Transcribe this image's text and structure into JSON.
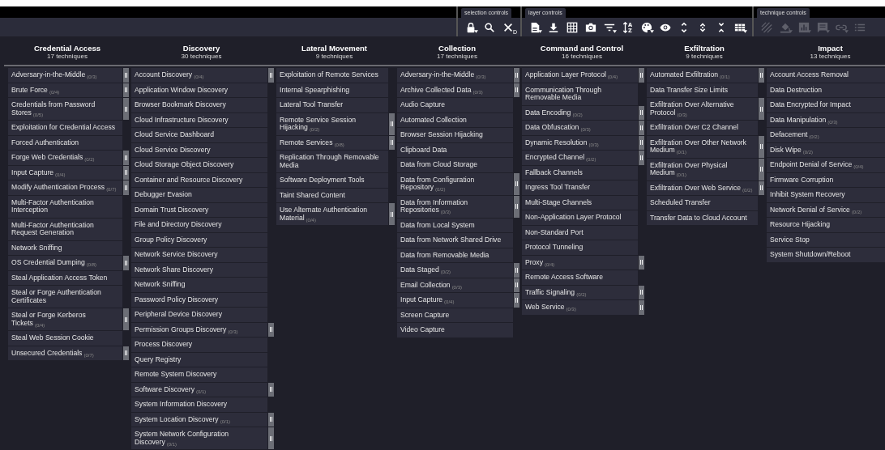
{
  "toolbar": {
    "groups": [
      {
        "label": "selection controls",
        "buttons": [
          {
            "kind": "lock",
            "dropdown": true,
            "disabled": false
          },
          {
            "kind": "search",
            "dropdown": false,
            "disabled": false
          },
          {
            "kind": "clear",
            "badge": "D",
            "dropdown": false,
            "disabled": false
          }
        ]
      },
      {
        "label": "layer controls",
        "buttons": [
          {
            "kind": "file",
            "dropdown": true,
            "disabled": false
          },
          {
            "kind": "download",
            "dropdown": false,
            "disabled": false
          },
          {
            "kind": "grid",
            "dropdown": false,
            "disabled": false
          },
          {
            "kind": "camera",
            "dropdown": false,
            "disabled": false
          },
          {
            "kind": "filter",
            "dropdown": true,
            "disabled": false
          },
          {
            "kind": "sort",
            "letters": [
              "A",
              "Z"
            ],
            "dropdown": false,
            "disabled": false
          },
          {
            "kind": "palette",
            "dropdown": true,
            "disabled": false
          },
          {
            "kind": "eye",
            "dropdown": false,
            "disabled": false
          },
          {
            "kind": "expand",
            "dropdown": false,
            "disabled": false
          },
          {
            "kind": "chevrons",
            "dropdown": false,
            "disabled": false
          },
          {
            "kind": "collapse",
            "dropdown": false,
            "disabled": false
          },
          {
            "kind": "table",
            "dropdown": true,
            "disabled": false
          }
        ]
      },
      {
        "label": "technique controls",
        "buttons": [
          {
            "kind": "hatch",
            "dropdown": false,
            "disabled": true
          },
          {
            "kind": "bucket",
            "dropdown": true,
            "disabled": true
          },
          {
            "kind": "barchart",
            "dropdown": true,
            "disabled": true
          },
          {
            "kind": "comment",
            "dropdown": true,
            "disabled": true
          },
          {
            "kind": "link",
            "dropdown": true,
            "disabled": true
          },
          {
            "kind": "list",
            "dropdown": false,
            "disabled": true
          }
        ]
      }
    ]
  },
  "tactics": [
    {
      "name": "Credential Access",
      "count": "17 techniques",
      "techniques": [
        {
          "name": "Adversary-in-the-Middle",
          "count": "(0/3)"
        },
        {
          "name": "Brute Force",
          "count": "(0/4)"
        },
        {
          "name": "Credentials from Password Stores",
          "count": "(0/5)"
        },
        {
          "name": "Exploitation for Credential Access"
        },
        {
          "name": "Forced Authentication"
        },
        {
          "name": "Forge Web Credentials",
          "count": "(0/2)"
        },
        {
          "name": "Input Capture",
          "count": "(0/4)"
        },
        {
          "name": "Modify Authentication Process",
          "count": "(0/7)"
        },
        {
          "name": "Multi-Factor Authentication Interception"
        },
        {
          "name": "Multi-Factor Authentication Request Generation"
        },
        {
          "name": "Network Sniffing"
        },
        {
          "name": "OS Credential Dumping",
          "count": "(0/8)"
        },
        {
          "name": "Steal Application Access Token"
        },
        {
          "name": "Steal or Forge Authentication Certificates"
        },
        {
          "name": "Steal or Forge Kerberos Tickets",
          "count": "(0/4)"
        },
        {
          "name": "Steal Web Session Cookie"
        },
        {
          "name": "Unsecured Credentials",
          "count": "(0/7)"
        }
      ]
    },
    {
      "name": "Discovery",
      "count": "30 techniques",
      "techniques": [
        {
          "name": "Account Discovery",
          "count": "(0/4)"
        },
        {
          "name": "Application Window Discovery"
        },
        {
          "name": "Browser Bookmark Discovery"
        },
        {
          "name": "Cloud Infrastructure Discovery"
        },
        {
          "name": "Cloud Service Dashboard"
        },
        {
          "name": "Cloud Service Discovery"
        },
        {
          "name": "Cloud Storage Object Discovery"
        },
        {
          "name": "Container and Resource Discovery"
        },
        {
          "name": "Debugger Evasion"
        },
        {
          "name": "Domain Trust Discovery"
        },
        {
          "name": "File and Directory Discovery"
        },
        {
          "name": "Group Policy Discovery"
        },
        {
          "name": "Network Service Discovery"
        },
        {
          "name": "Network Share Discovery"
        },
        {
          "name": "Network Sniffing"
        },
        {
          "name": "Password Policy Discovery"
        },
        {
          "name": "Peripheral Device Discovery"
        },
        {
          "name": "Permission Groups Discovery",
          "count": "(0/3)"
        },
        {
          "name": "Process Discovery"
        },
        {
          "name": "Query Registry"
        },
        {
          "name": "Remote System Discovery"
        },
        {
          "name": "Software Discovery",
          "count": "(0/1)"
        },
        {
          "name": "System Information Discovery"
        },
        {
          "name": "System Location Discovery",
          "count": "(0/1)"
        },
        {
          "name": "System Network Configuration Discovery",
          "count": "(0/1)"
        }
      ]
    },
    {
      "name": "Lateral Movement",
      "count": "9 techniques",
      "techniques": [
        {
          "name": "Exploitation of Remote Services"
        },
        {
          "name": "Internal Spearphishing"
        },
        {
          "name": "Lateral Tool Transfer"
        },
        {
          "name": "Remote Service Session Hijacking",
          "count": "(0/2)"
        },
        {
          "name": "Remote Services",
          "count": "(0/8)"
        },
        {
          "name": "Replication Through Removable Media"
        },
        {
          "name": "Software Deployment Tools"
        },
        {
          "name": "Taint Shared Content"
        },
        {
          "name": "Use Alternate Authentication Material",
          "count": "(0/4)"
        }
      ]
    },
    {
      "name": "Collection",
      "count": "17 techniques",
      "techniques": [
        {
          "name": "Adversary-in-the-Middle",
          "count": "(0/3)"
        },
        {
          "name": "Archive Collected Data",
          "count": "(0/3)"
        },
        {
          "name": "Audio Capture"
        },
        {
          "name": "Automated Collection"
        },
        {
          "name": "Browser Session Hijacking"
        },
        {
          "name": "Clipboard Data"
        },
        {
          "name": "Data from Cloud Storage"
        },
        {
          "name": "Data from Configuration Repository",
          "count": "(0/2)"
        },
        {
          "name": "Data from Information Repositories",
          "count": "(0/3)"
        },
        {
          "name": "Data from Local System"
        },
        {
          "name": "Data from Network Shared Drive"
        },
        {
          "name": "Data from Removable Media"
        },
        {
          "name": "Data Staged",
          "count": "(0/2)"
        },
        {
          "name": "Email Collection",
          "count": "(0/3)"
        },
        {
          "name": "Input Capture",
          "count": "(0/4)"
        },
        {
          "name": "Screen Capture"
        },
        {
          "name": "Video Capture"
        }
      ]
    },
    {
      "name": "Command and Control",
      "count": "16 techniques",
      "techniques": [
        {
          "name": "Application Layer Protocol",
          "count": "(0/4)"
        },
        {
          "name": "Communication Through Removable Media"
        },
        {
          "name": "Data Encoding",
          "count": "(0/2)"
        },
        {
          "name": "Data Obfuscation",
          "count": "(0/3)"
        },
        {
          "name": "Dynamic Resolution",
          "count": "(0/3)"
        },
        {
          "name": "Encrypted Channel",
          "count": "(0/2)"
        },
        {
          "name": "Fallback Channels"
        },
        {
          "name": "Ingress Tool Transfer"
        },
        {
          "name": "Multi-Stage Channels"
        },
        {
          "name": "Non-Application Layer Protocol"
        },
        {
          "name": "Non-Standard Port"
        },
        {
          "name": "Protocol Tunneling"
        },
        {
          "name": "Proxy",
          "count": "(0/4)"
        },
        {
          "name": "Remote Access Software"
        },
        {
          "name": "Traffic Signaling",
          "count": "(0/2)"
        },
        {
          "name": "Web Service",
          "count": "(0/3)"
        }
      ]
    },
    {
      "name": "Exfiltration",
      "count": "9 techniques",
      "techniques": [
        {
          "name": "Automated Exfiltration",
          "count": "(0/1)"
        },
        {
          "name": "Data Transfer Size Limits"
        },
        {
          "name": "Exfiltration Over Alternative Protocol",
          "count": "(0/3)"
        },
        {
          "name": "Exfiltration Over C2 Channel"
        },
        {
          "name": "Exfiltration Over Other Network Medium",
          "count": "(0/1)"
        },
        {
          "name": "Exfiltration Over Physical Medium",
          "count": "(0/1)"
        },
        {
          "name": "Exfiltration Over Web Service",
          "count": "(0/2)"
        },
        {
          "name": "Scheduled Transfer"
        },
        {
          "name": "Transfer Data to Cloud Account"
        }
      ]
    },
    {
      "name": "Impact",
      "count": "13 techniques",
      "techniques": [
        {
          "name": "Account Access Removal"
        },
        {
          "name": "Data Destruction"
        },
        {
          "name": "Data Encrypted for Impact"
        },
        {
          "name": "Data Manipulation",
          "count": "(0/3)"
        },
        {
          "name": "Defacement",
          "count": "(0/2)"
        },
        {
          "name": "Disk Wipe",
          "count": "(0/2)"
        },
        {
          "name": "Endpoint Denial of Service",
          "count": "(0/4)"
        },
        {
          "name": "Firmware Corruption"
        },
        {
          "name": "Inhibit System Recovery"
        },
        {
          "name": "Network Denial of Service",
          "count": "(0/2)"
        },
        {
          "name": "Resource Hijacking"
        },
        {
          "name": "Service Stop"
        },
        {
          "name": "System Shutdown/Reboot"
        }
      ]
    }
  ]
}
